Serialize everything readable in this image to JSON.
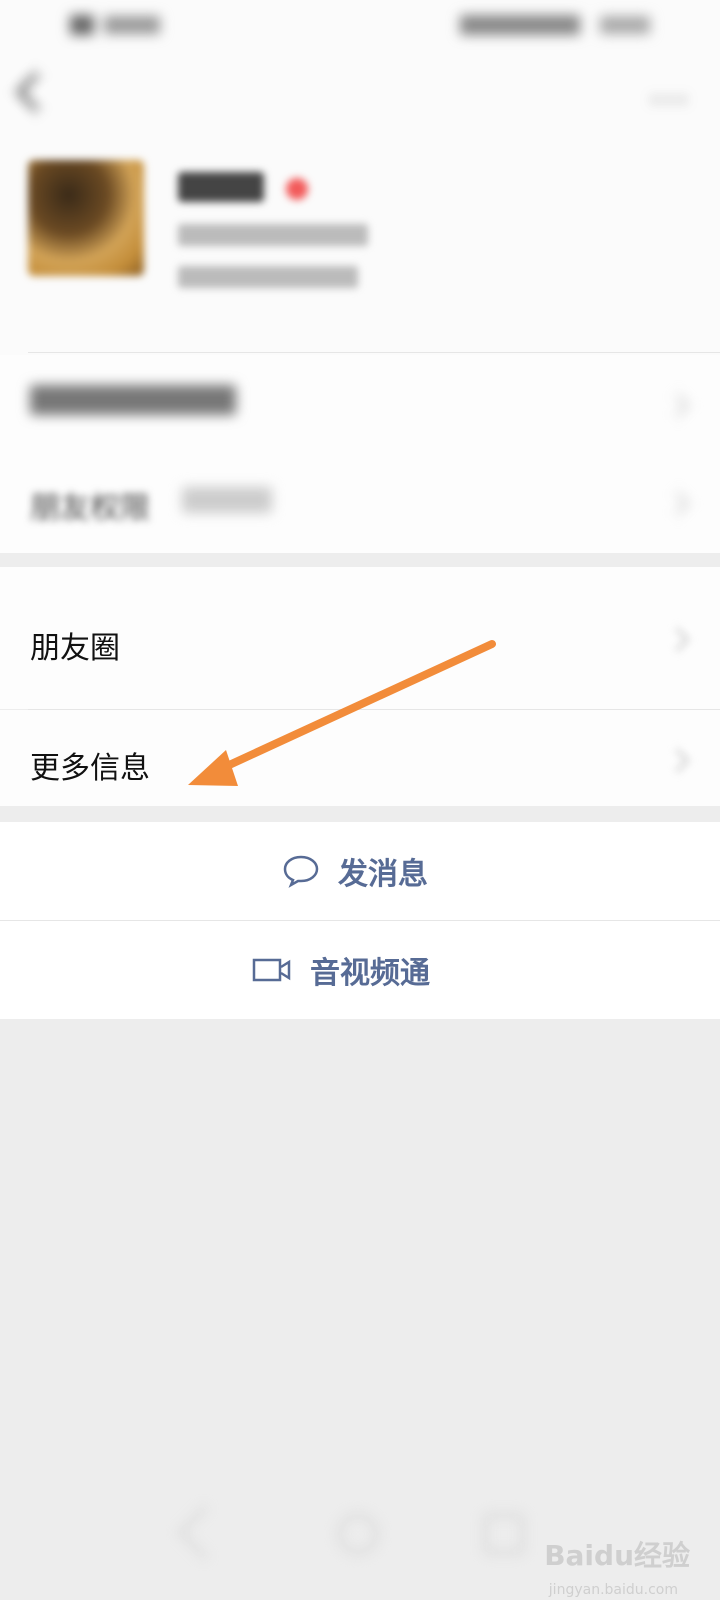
{
  "status_bar": {
    "left_text": "",
    "right_text": ""
  },
  "profile": {
    "nickname": "",
    "wechat_id": "",
    "region": ""
  },
  "rows": {
    "remark_tags": {
      "label": ""
    },
    "friend_permissions": {
      "label": "朋友权限",
      "value": ""
    },
    "moments": {
      "label": "朋友圈"
    },
    "more_info": {
      "label": "更多信息"
    }
  },
  "actions": {
    "send_message": "发消息",
    "video_call": "音视频通"
  },
  "watermark": {
    "brand": "Baidu经验",
    "url": "jingyan.baidu.com"
  },
  "colors": {
    "accent_action": "#576b95",
    "annotation_arrow": "#f28c3a",
    "page_bg": "#ededed"
  },
  "icons": [
    "back-icon",
    "more-icon",
    "chat-bubble-icon",
    "video-camera-icon",
    "chevron-right-icon",
    "nav-back-icon",
    "nav-home-icon",
    "nav-recent-icon"
  ]
}
